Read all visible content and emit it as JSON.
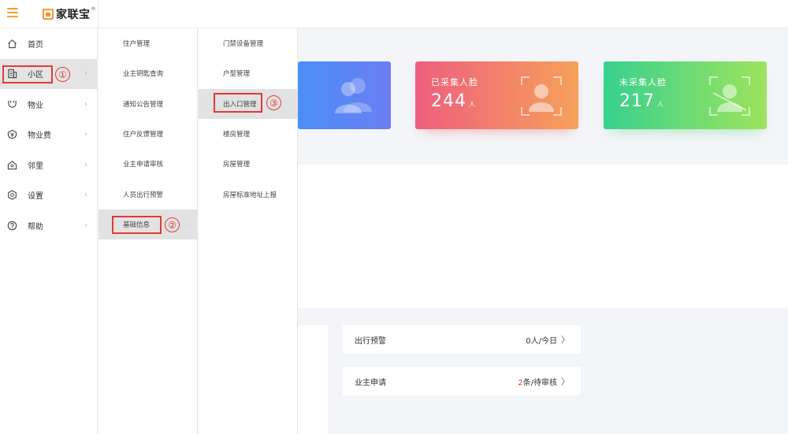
{
  "app": {
    "brand": "家联宝",
    "brand_mark": "®"
  },
  "nav1": {
    "items": [
      {
        "label": "首页",
        "icon": "home-icon"
      },
      {
        "label": "小区",
        "icon": "community-icon",
        "active": true
      },
      {
        "label": "物业",
        "icon": "property-icon"
      },
      {
        "label": "物业费",
        "icon": "property-fee-icon"
      },
      {
        "label": "邻里",
        "icon": "neighbor-icon"
      },
      {
        "label": "设置",
        "icon": "settings-icon"
      },
      {
        "label": "帮助",
        "icon": "help-icon"
      }
    ]
  },
  "nav2": {
    "items": [
      {
        "label": "住户管理"
      },
      {
        "label": "业主钥匙查询"
      },
      {
        "label": "通知公告管理"
      },
      {
        "label": "住户反馈管理"
      },
      {
        "label": "业主申请审核"
      },
      {
        "label": "人员出行预警"
      },
      {
        "label": "基础信息",
        "active": true
      }
    ]
  },
  "nav3": {
    "items": [
      {
        "label": "门禁设备管理"
      },
      {
        "label": "户型管理"
      },
      {
        "label": "出入口管理",
        "active": true
      },
      {
        "label": "楼房管理"
      },
      {
        "label": "房屋管理"
      },
      {
        "label": "房屋标准地址上报"
      }
    ]
  },
  "annotations": {
    "step1": "①",
    "step2": "②",
    "step3": "③"
  },
  "stats": {
    "collected": {
      "title": "已采集人脸",
      "value": "244",
      "unit": "人"
    },
    "uncollected": {
      "title": "未采集人脸",
      "value": "217",
      "unit": "人"
    }
  },
  "info": {
    "travel_warning": {
      "label": "出行预警",
      "value": "0人/今日"
    },
    "owner_apply": {
      "label": "业主申请",
      "count": "2",
      "suffix": "条/待审核"
    }
  },
  "colors": {
    "accent": "#f29a2e",
    "annotation": "#e53935",
    "card_red_start": "#ee5f7e",
    "card_red_end": "#f5a15a",
    "card_green_start": "#37d18f",
    "card_green_end": "#9ee35c",
    "card_blue_start": "#4a8ef7"
  }
}
